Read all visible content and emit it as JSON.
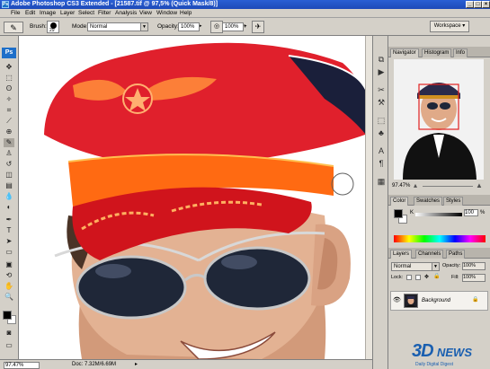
{
  "window": {
    "title": "Adobe Photoshop CS3 Extended - [21587.tif @ 97,5% (Quick Mask/8)]",
    "controls": [
      "_",
      "□",
      "×"
    ]
  },
  "menu": [
    "File",
    "Edit",
    "Image",
    "Layer",
    "Select",
    "Filter",
    "Analysis",
    "View",
    "Window",
    "Help"
  ],
  "options": {
    "brush_label": "Brush:",
    "brush_size": "29",
    "mode_label": "Mode:",
    "mode_value": "Normal",
    "opacity_label": "Opacity:",
    "opacity_value": "100%",
    "flow_label": "Flow:",
    "flow_value": "100%",
    "workspace_label": "Workspace ▾"
  },
  "navigator": {
    "tabs": [
      "Navigator",
      "Histogram",
      "Info"
    ],
    "zoom": "97.47%"
  },
  "color": {
    "tabs": [
      "Color",
      "Swatches",
      "Styles"
    ],
    "channel_label": "K",
    "channel_value": "100",
    "percent": "%"
  },
  "layers": {
    "tabs": [
      "Layers",
      "Channels",
      "Paths"
    ],
    "blend_mode": "Normal",
    "opacity_label": "Opacity:",
    "opacity_value": "100%",
    "lock_label": "Lock:",
    "fill_label": "Fill:",
    "fill_value": "100%",
    "layer_name": "Background"
  },
  "status": {
    "zoom": "97.47%",
    "doc": "Doc: 7.32M/6.69M"
  },
  "watermark": {
    "brand_left": "3D",
    "brand_right": "NEWS",
    "tagline": "Daily Digital Digest"
  },
  "colors": {
    "mask_red": "#e0202c",
    "titlebar": "#1d4ab8",
    "panel_bg": "#d4d0c8"
  }
}
